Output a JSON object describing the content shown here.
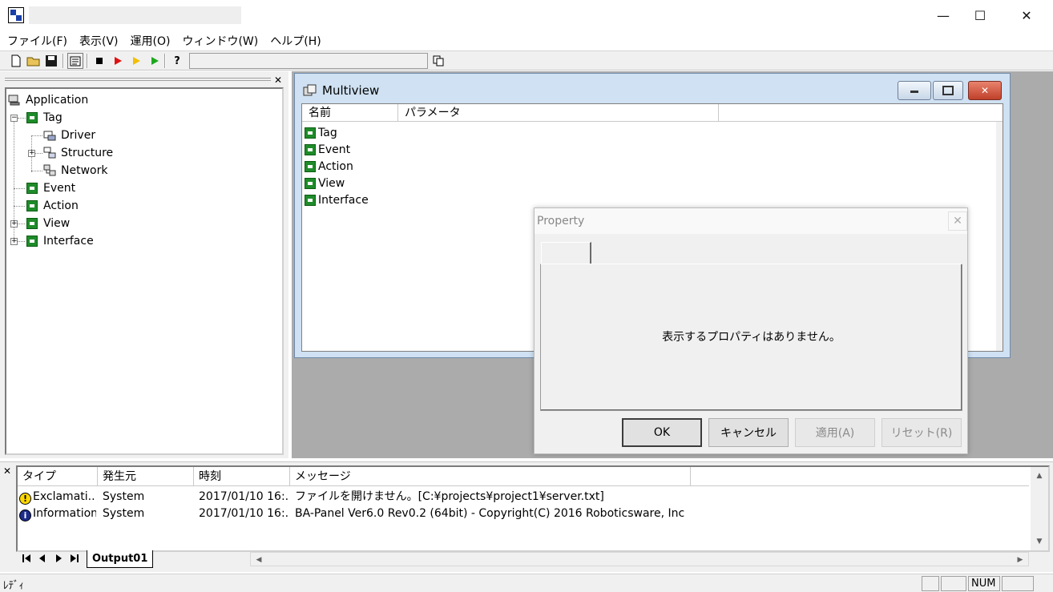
{
  "window": {
    "title": "",
    "minimize_glyph": "—",
    "maximize_glyph": "☐",
    "close_glyph": "✕"
  },
  "menubar": {
    "items": [
      "ファイル(F)",
      "表示(V)",
      "運用(O)",
      "ウィンドウ(W)",
      "ヘルプ(H)"
    ]
  },
  "toolbar": {
    "combo_value": "",
    "icons": [
      "new-file-icon",
      "open-folder-icon",
      "save-icon",
      "properties-icon",
      "stop-icon",
      "run-red-icon",
      "run-yellow-icon",
      "run-green-icon",
      "help-icon",
      "copy-icon"
    ]
  },
  "tree": {
    "close_glyph": "✕",
    "items": [
      {
        "label": "Application",
        "icon": "application-icon"
      },
      {
        "label": "Tag",
        "icon": "tag-icon"
      },
      {
        "label": "Driver",
        "icon": "driver-icon"
      },
      {
        "label": "Structure",
        "icon": "structure-icon"
      },
      {
        "label": "Network",
        "icon": "network-icon"
      },
      {
        "label": "Event",
        "icon": "event-icon"
      },
      {
        "label": "Action",
        "icon": "action-icon"
      },
      {
        "label": "View",
        "icon": "view-icon"
      },
      {
        "label": "Interface",
        "icon": "interface-icon"
      }
    ]
  },
  "multiview": {
    "title": "Multiview",
    "columns": [
      "名前",
      "パラメータ"
    ],
    "rows": [
      "Tag",
      "Event",
      "Action",
      "View",
      "Interface"
    ]
  },
  "property": {
    "title": "Property",
    "close_glyph": "✕",
    "message": "表示するプロパティはありません。",
    "buttons": {
      "ok": "OK",
      "cancel": "キャンセル",
      "apply": "適用(A)",
      "reset": "リセット(R)"
    }
  },
  "output": {
    "close_glyph": "✕",
    "columns": [
      "タイプ",
      "発生元",
      "時刻",
      "メッセージ"
    ],
    "rows": [
      {
        "type": "Exclamati...",
        "source": "System",
        "time": "2017/01/10 16:...",
        "message": "ファイルを開けません。[C:¥projects¥project1¥server.txt]",
        "icon": "exclamation-icon"
      },
      {
        "type": "Information",
        "source": "System",
        "time": "2017/01/10 16:...",
        "message": "BA-Panel Ver6.0 Rev0.2 (64bit) - Copyright(C) 2016 Roboticsware, Inc",
        "icon": "information-icon"
      }
    ],
    "tab_label": "Output01"
  },
  "statusbar": {
    "text": "ﾚﾃﾞｨ",
    "num": "NUM"
  },
  "colors": {
    "tree_icon_green": "#1f8b2a",
    "mdi_background": "#ababab",
    "window_frame": "#cfe1f2",
    "close_button_red": "#c0402a"
  }
}
